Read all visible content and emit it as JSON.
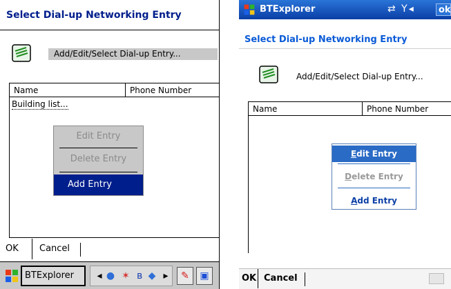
{
  "left": {
    "title": "Select Dial-up Networking Entry",
    "entry_text": "Add/Edit/Select Dial-up Entry...",
    "columns": [
      "Name",
      "Phone Number"
    ],
    "status_text": "Building list...",
    "menu_items": [
      {
        "label": "Edit Entry",
        "state": "disabled"
      },
      {
        "label": "Delete Entry",
        "state": "disabled"
      },
      {
        "label": "Add Entry",
        "state": "selected"
      }
    ],
    "softkeys": {
      "ok": "OK",
      "cancel": "Cancel"
    },
    "taskbar": {
      "app": "BTExplorer",
      "icons": [
        "start-icon",
        "network-icon",
        "bluetooth-icon",
        "sound-icon",
        "pen-icon",
        "windows-icon"
      ]
    }
  },
  "right": {
    "app_title": "BTExplorer",
    "status_icons": [
      "connectivity-icon",
      "signal-icon",
      "volume-icon"
    ],
    "ok_label": "ok",
    "subtitle": "Select Dial-up Networking Entry",
    "entry_text": "Add/Edit/Select Dial-up Entry...",
    "columns": [
      "Name",
      "Phone Number"
    ],
    "menu_items": [
      {
        "label": "Edit Entry",
        "underline": "E",
        "rest": "dit Entry",
        "state": "selected"
      },
      {
        "label": "Delete Entry",
        "underline": "D",
        "rest": "elete Entry",
        "state": "disabled"
      },
      {
        "label": "Add Entry",
        "underline": "A",
        "rest": "dd Entry",
        "state": "enabled"
      }
    ],
    "softkeys": {
      "ok": "OK",
      "cancel": "Cancel"
    }
  },
  "colors": {
    "dark_blue": "#001e8c",
    "title_blue": "#0b3fa6",
    "highlight": "#2a6bc6",
    "disabled": "#9a9a9a",
    "menu_gray": "#c8c8c8"
  }
}
